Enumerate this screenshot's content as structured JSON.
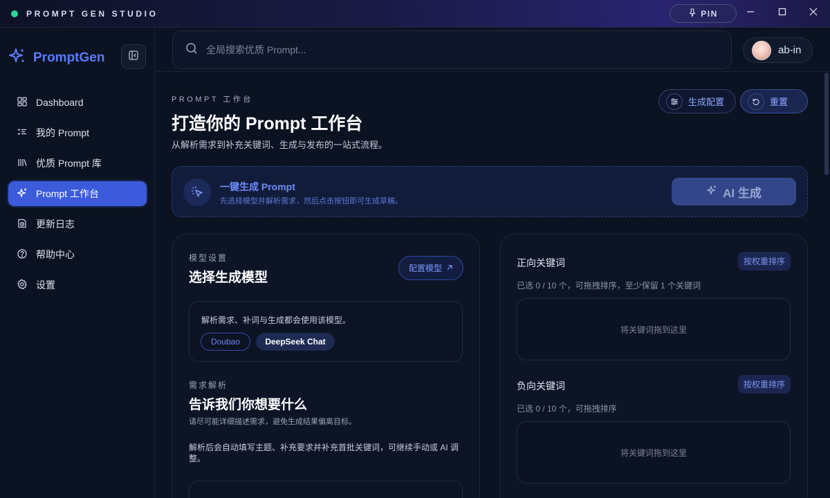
{
  "titlebar": {
    "app_name": "PROMPT GEN STUDIO",
    "pin_label": "PIN",
    "status_color": "#2fd39a"
  },
  "sidebar": {
    "brand": "PromptGen",
    "items": [
      {
        "label": "Dashboard",
        "icon": "dashboard-icon",
        "active": false
      },
      {
        "label": "我的 Prompt",
        "icon": "list-check-icon",
        "active": false
      },
      {
        "label": "优质 Prompt 库",
        "icon": "library-icon",
        "active": false
      },
      {
        "label": "Prompt 工作台",
        "icon": "sparkles-icon",
        "active": true
      },
      {
        "label": "更新日志",
        "icon": "history-icon",
        "active": false
      },
      {
        "label": "帮助中心",
        "icon": "help-icon",
        "active": false
      },
      {
        "label": "设置",
        "icon": "gear-icon",
        "active": false
      }
    ]
  },
  "topbar": {
    "search_placeholder": "全局搜索优质 Prompt...",
    "username": "ab-in"
  },
  "header": {
    "eyebrow": "PROMPT 工作台",
    "title": "打造你的 Prompt 工作台",
    "subtitle": "从解析需求到补充关键词、生成与发布的一站式流程。",
    "config_label": "生成配置",
    "reset_label": "重置"
  },
  "banner": {
    "title": "一键生成 Prompt",
    "subtitle": "先选择模型并解析需求，然后点击按钮即可生成草稿。",
    "ai_button": "AI 生成"
  },
  "model_section": {
    "eyebrow": "模型设置",
    "title": "选择生成模型",
    "config_button": "配置模型",
    "hint": "解析需求、补词与生成都会使用该模型。",
    "models": [
      "Doubao",
      "DeepSeek Chat"
    ],
    "selected": "DeepSeek Chat"
  },
  "requirement_section": {
    "eyebrow": "需求解析",
    "title": "告诉我们你想要什么",
    "desc": "请尽可能详细描述需求，避免生成结果偏离目标。",
    "note": "解析后会自动填写主题、补充要求并补充首批关键词，可继续手动或 AI 调整。"
  },
  "keywords": {
    "positive": {
      "title": "正向关键词",
      "sort_label": "按权重排序",
      "meta": "已选 0 / 10 个，可拖拽排序，至少保留 1 个关键词",
      "drop_hint": "将关键词拖到这里"
    },
    "negative": {
      "title": "负向关键词",
      "sort_label": "按权重排序",
      "meta": "已选 0 / 10 个，可拖拽排序",
      "drop_hint": "将关键词拖到这里"
    }
  },
  "colors": {
    "accent": "#3b5bdb",
    "brand": "#5a7bff",
    "background": "#0b1221"
  }
}
